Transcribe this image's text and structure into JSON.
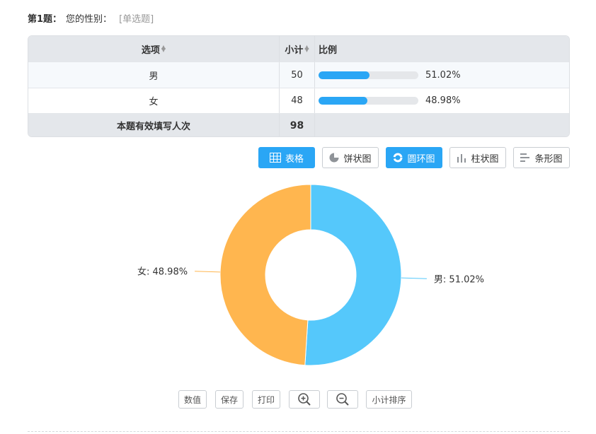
{
  "question": {
    "number": "第1题：",
    "text": "您的性别：",
    "type": "[单选题]"
  },
  "table": {
    "headers": {
      "option": "选项",
      "count": "小计",
      "ratio": "比例"
    },
    "rows": [
      {
        "option": "男",
        "count": "50",
        "percent": "51.02%",
        "fraction": 0.5102
      },
      {
        "option": "女",
        "count": "48",
        "percent": "48.98%",
        "fraction": 0.4898
      }
    ],
    "total": {
      "label": "本题有效填写人次",
      "count": "98"
    }
  },
  "view_buttons": {
    "table": "表格",
    "pie": "饼状图",
    "donut": "圆环图",
    "column": "柱状图",
    "bar": "条形图"
  },
  "tool_buttons": {
    "values": "数值",
    "save": "保存",
    "print": "打印",
    "zoom_in": "zoom-in-icon",
    "zoom_out": "zoom-out-icon",
    "sort": "小计排序"
  },
  "colors": {
    "accent": "#2aa6f5",
    "male": "#55c8fb",
    "female": "#ffb64f"
  },
  "chart_data": {
    "type": "pie",
    "variant": "donut",
    "title": "",
    "slices": [
      {
        "label": "男",
        "value": 51.02,
        "color": "#55c8fb",
        "data_label": "男: 51.02%"
      },
      {
        "label": "女",
        "value": 48.98,
        "color": "#ffb64f",
        "data_label": "女: 48.98%"
      }
    ]
  }
}
